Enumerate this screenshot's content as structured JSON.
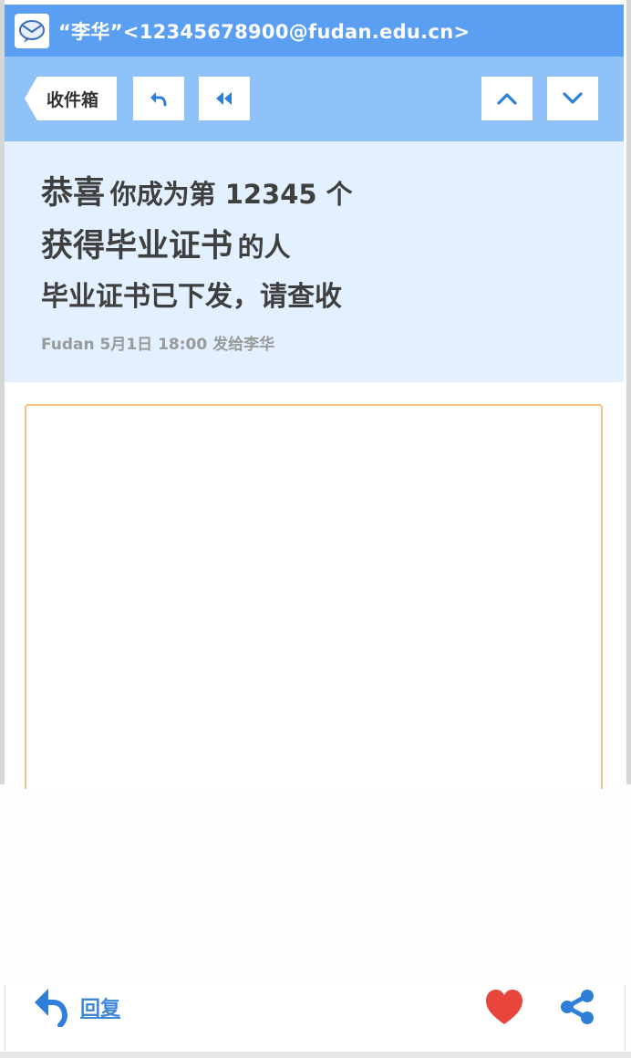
{
  "titlebar": {
    "sender": "“李华”<12345678900@fudan.edu.cn>"
  },
  "toolbar": {
    "inbox_label": "收件箱"
  },
  "header": {
    "subject": {
      "line1_big": "恭喜",
      "line1_rest": "你成为第 12345 个",
      "line2_big": "获得毕业证书",
      "line2_rest": "的人",
      "line3": "毕业证书已下发，请查收"
    },
    "meta": "Fudan 5月1日 18:00 发给李华"
  },
  "bottombar": {
    "reply_label": "回复"
  },
  "colors": {
    "titlebar": "#5b9ff3",
    "toolbar": "#90c2fa",
    "header": "#e2f0ff",
    "accent_blue": "#3d86d8",
    "heart": "#e8453c",
    "content_border": "#f6c27c"
  },
  "icons": {
    "app": "mail-app-icon",
    "reply": "reply-icon",
    "reply_all": "reply-all-icon",
    "prev": "chevron-up-icon",
    "next": "chevron-down-icon",
    "favorite": "heart-icon",
    "share": "share-icon"
  }
}
